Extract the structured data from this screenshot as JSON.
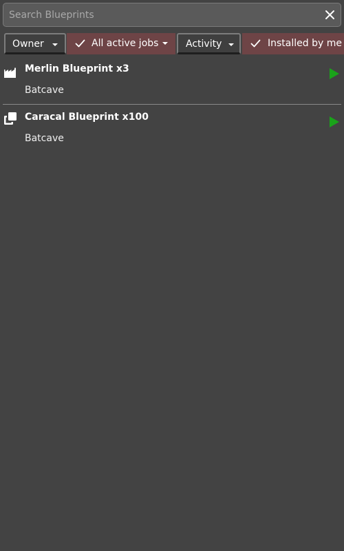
{
  "search": {
    "placeholder": "Search Blueprints",
    "value": ""
  },
  "filters": [
    {
      "label": "Owner",
      "checked": false,
      "active": false
    },
    {
      "label": "All active jobs",
      "checked": true,
      "active": true
    },
    {
      "label": "Activity",
      "checked": false,
      "active": false
    },
    {
      "label": "Installed by me",
      "checked": true,
      "active": true
    }
  ],
  "jobs": [
    {
      "title": "Merlin Blueprint x3",
      "location": "Batcave",
      "icon": "factory-icon"
    },
    {
      "title": "Caracal Blueprint x100",
      "location": "Batcave",
      "icon": "copy-icon"
    }
  ],
  "colors": {
    "background": "#434343",
    "active_filter": "#6e4446",
    "play": "#1aa31a"
  }
}
